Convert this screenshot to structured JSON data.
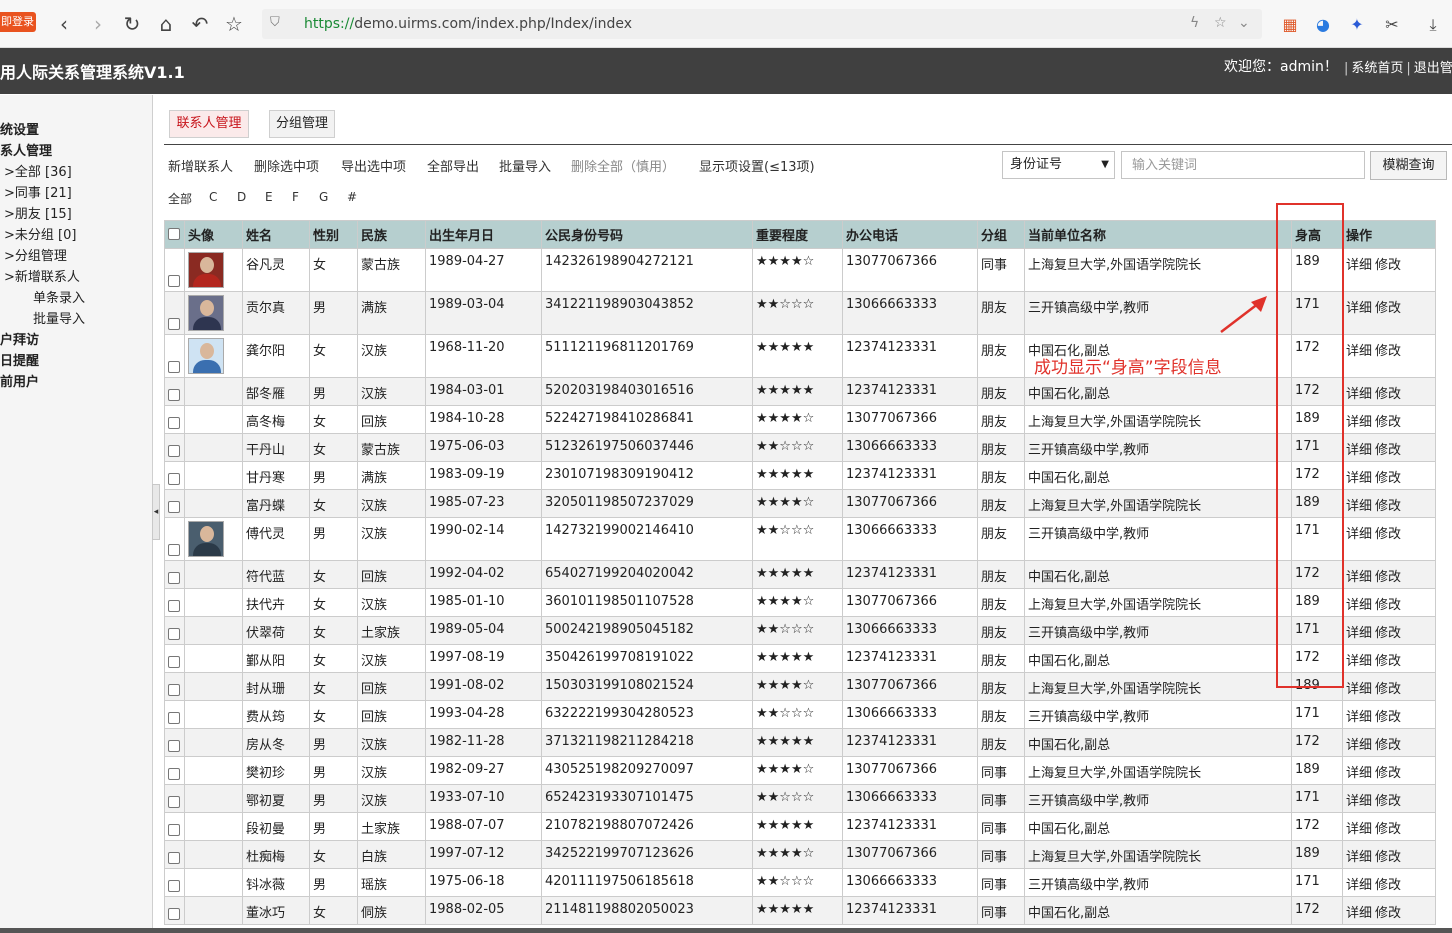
{
  "browser": {
    "login_badge": "即登录",
    "url_https": "https://",
    "url_rest": "demo.uirms.com/index.php/Index/index"
  },
  "header": {
    "title": "用人际关系管理系统V1.1",
    "welcome": "欢迎您：admin！",
    "home_link": "系统首页",
    "logout_link": "退出管"
  },
  "sidebar": {
    "items": [
      {
        "label": "统设置",
        "bold": true,
        "indent": 0
      },
      {
        "label": "系人管理",
        "bold": true,
        "indent": 0
      },
      {
        "label": ">全部 [36]",
        "bold": false,
        "indent": 4
      },
      {
        "label": ">同事 [21]",
        "bold": false,
        "indent": 4
      },
      {
        "label": ">朋友 [15]",
        "bold": false,
        "indent": 4
      },
      {
        "label": ">未分组 [0]",
        "bold": false,
        "indent": 4
      },
      {
        "label": ">分组管理",
        "bold": false,
        "indent": 4
      },
      {
        "label": ">新增联系人",
        "bold": false,
        "indent": 4
      },
      {
        "label": "单条录入",
        "bold": false,
        "indent": 33
      },
      {
        "label": "批量导入",
        "bold": false,
        "indent": 33
      },
      {
        "label": "户拜访",
        "bold": true,
        "indent": 0
      },
      {
        "label": "日提醒",
        "bold": true,
        "indent": 0
      },
      {
        "label": "前用户",
        "bold": true,
        "indent": 0
      }
    ]
  },
  "tabs": [
    {
      "label": "联系人管理",
      "active": true
    },
    {
      "label": "分组管理",
      "active": false
    }
  ],
  "toolbar": [
    {
      "label": "新增联系人",
      "dim": false
    },
    {
      "label": "删除选中项",
      "dim": false
    },
    {
      "label": "导出选中项",
      "dim": false
    },
    {
      "label": "全部导出",
      "dim": false
    },
    {
      "label": "批量导入",
      "dim": false
    },
    {
      "label": "删除全部（慎用）",
      "dim": true
    },
    {
      "label": "显示项设置(≤13项)",
      "dim": false
    }
  ],
  "search": {
    "field_selected": "身份证号",
    "placeholder": "输入关键词",
    "button": "模糊查询"
  },
  "letters": [
    "全部",
    "C",
    "D",
    "E",
    "F",
    "G",
    "#"
  ],
  "table": {
    "columns": [
      "头像",
      "姓名",
      "性别",
      "民族",
      "出生年月日",
      "公民身份号码",
      "重要程度",
      "办公电话",
      "分组",
      "当前单位名称",
      "身高",
      "操作"
    ],
    "op_detail": "详细",
    "op_edit": "修改",
    "rows": [
      {
        "photo": "red",
        "name": "谷凡灵",
        "gender": "女",
        "ethnic": "蒙古族",
        "dob": "1989-04-27",
        "id": "142326198904272121",
        "stars": "★★★★☆",
        "phone": "13077067366",
        "group": "同事",
        "org": "上海复旦大学,外国语学院院长",
        "height": "189"
      },
      {
        "photo": "suit",
        "name": "贡尔真",
        "gender": "男",
        "ethnic": "满族",
        "dob": "1989-03-04",
        "id": "341221198903043852",
        "stars": "★★☆☆☆",
        "phone": "13066663333",
        "group": "朋友",
        "org": "三开镇高级中学,教师",
        "height": "171"
      },
      {
        "photo": "light",
        "name": "龚尔阳",
        "gender": "女",
        "ethnic": "汉族",
        "dob": "1968-11-20",
        "id": "511121196811201769",
        "stars": "★★★★★",
        "phone": "12374123331",
        "group": "朋友",
        "org": "中国石化,副总",
        "height": "172"
      },
      {
        "photo": "",
        "name": "郜冬雁",
        "gender": "男",
        "ethnic": "汉族",
        "dob": "1984-03-01",
        "id": "520203198403016516",
        "stars": "★★★★★",
        "phone": "12374123331",
        "group": "朋友",
        "org": "中国石化,副总",
        "height": "172"
      },
      {
        "photo": "",
        "name": "高冬梅",
        "gender": "女",
        "ethnic": "回族",
        "dob": "1984-10-28",
        "id": "522427198410286841",
        "stars": "★★★★☆",
        "phone": "13077067366",
        "group": "朋友",
        "org": "上海复旦大学,外国语学院院长",
        "height": "189"
      },
      {
        "photo": "",
        "name": "干丹山",
        "gender": "女",
        "ethnic": "蒙古族",
        "dob": "1975-06-03",
        "id": "512326197506037446",
        "stars": "★★☆☆☆",
        "phone": "13066663333",
        "group": "朋友",
        "org": "三开镇高级中学,教师",
        "height": "171"
      },
      {
        "photo": "",
        "name": "甘丹寒",
        "gender": "男",
        "ethnic": "满族",
        "dob": "1983-09-19",
        "id": "230107198309190412",
        "stars": "★★★★★",
        "phone": "12374123331",
        "group": "朋友",
        "org": "中国石化,副总",
        "height": "172"
      },
      {
        "photo": "",
        "name": "富丹蝶",
        "gender": "女",
        "ethnic": "汉族",
        "dob": "1985-07-23",
        "id": "320501198507237029",
        "stars": "★★★★☆",
        "phone": "13077067366",
        "group": "朋友",
        "org": "上海复旦大学,外国语学院院长",
        "height": "189"
      },
      {
        "photo": "dark",
        "name": "傅代灵",
        "gender": "男",
        "ethnic": "汉族",
        "dob": "1990-02-14",
        "id": "142732199002146410",
        "stars": "★★☆☆☆",
        "phone": "13066663333",
        "group": "朋友",
        "org": "三开镇高级中学,教师",
        "height": "171"
      },
      {
        "photo": "",
        "name": "符代蓝",
        "gender": "女",
        "ethnic": "回族",
        "dob": "1992-04-02",
        "id": "654027199204020042",
        "stars": "★★★★★",
        "phone": "12374123331",
        "group": "朋友",
        "org": "中国石化,副总",
        "height": "172"
      },
      {
        "photo": "",
        "name": "扶代卉",
        "gender": "女",
        "ethnic": "汉族",
        "dob": "1985-01-10",
        "id": "360101198501107528",
        "stars": "★★★★☆",
        "phone": "13077067366",
        "group": "朋友",
        "org": "上海复旦大学,外国语学院院长",
        "height": "189"
      },
      {
        "photo": "",
        "name": "伏翠荷",
        "gender": "女",
        "ethnic": "土家族",
        "dob": "1989-05-04",
        "id": "500242198905045182",
        "stars": "★★☆☆☆",
        "phone": "13066663333",
        "group": "朋友",
        "org": "三开镇高级中学,教师",
        "height": "171"
      },
      {
        "photo": "",
        "name": "鄞从阳",
        "gender": "女",
        "ethnic": "汉族",
        "dob": "1997-08-19",
        "id": "350426199708191022",
        "stars": "★★★★★",
        "phone": "12374123331",
        "group": "朋友",
        "org": "中国石化,副总",
        "height": "172"
      },
      {
        "photo": "",
        "name": "封从珊",
        "gender": "女",
        "ethnic": "回族",
        "dob": "1991-08-02",
        "id": "150303199108021524",
        "stars": "★★★★☆",
        "phone": "13077067366",
        "group": "朋友",
        "org": "上海复旦大学,外国语学院院长",
        "height": "189"
      },
      {
        "photo": "",
        "name": "费从筠",
        "gender": "女",
        "ethnic": "回族",
        "dob": "1993-04-28",
        "id": "632222199304280523",
        "stars": "★★☆☆☆",
        "phone": "13066663333",
        "group": "朋友",
        "org": "三开镇高级中学,教师",
        "height": "171"
      },
      {
        "photo": "",
        "name": "房从冬",
        "gender": "男",
        "ethnic": "汉族",
        "dob": "1982-11-28",
        "id": "371321198211284218",
        "stars": "★★★★★",
        "phone": "12374123331",
        "group": "朋友",
        "org": "中国石化,副总",
        "height": "172"
      },
      {
        "photo": "",
        "name": "樊初珍",
        "gender": "男",
        "ethnic": "汉族",
        "dob": "1982-09-27",
        "id": "430525198209270097",
        "stars": "★★★★☆",
        "phone": "13077067366",
        "group": "同事",
        "org": "上海复旦大学,外国语学院院长",
        "height": "189"
      },
      {
        "photo": "",
        "name": "鄂初夏",
        "gender": "男",
        "ethnic": "汉族",
        "dob": "1933-07-10",
        "id": "652423193307101475",
        "stars": "★★☆☆☆",
        "phone": "13066663333",
        "group": "同事",
        "org": "三开镇高级中学,教师",
        "height": "171"
      },
      {
        "photo": "",
        "name": "段初曼",
        "gender": "男",
        "ethnic": "土家族",
        "dob": "1988-07-07",
        "id": "210782198807072426",
        "stars": "★★★★★",
        "phone": "12374123331",
        "group": "同事",
        "org": "中国石化,副总",
        "height": "172"
      },
      {
        "photo": "",
        "name": "杜痴梅",
        "gender": "女",
        "ethnic": "白族",
        "dob": "1997-07-12",
        "id": "342522199707123626",
        "stars": "★★★★☆",
        "phone": "13077067366",
        "group": "同事",
        "org": "上海复旦大学,外国语学院院长",
        "height": "189"
      },
      {
        "photo": "",
        "name": "钭冰薇",
        "gender": "男",
        "ethnic": "瑶族",
        "dob": "1975-06-18",
        "id": "420111197506185618",
        "stars": "★★☆☆☆",
        "phone": "13066663333",
        "group": "同事",
        "org": "三开镇高级中学,教师",
        "height": "171"
      },
      {
        "photo": "",
        "name": "董冰巧",
        "gender": "女",
        "ethnic": "侗族",
        "dob": "1988-02-05",
        "id": "211481198802050023",
        "stars": "★★★★★",
        "phone": "12374123331",
        "group": "同事",
        "org": "中国石化,副总",
        "height": "172"
      }
    ]
  },
  "annotation": {
    "text": "成功显示“身高”字段信息",
    "color": "#e0322b"
  },
  "colors": {
    "header_bg": "#404040",
    "table_header_bg": "#b6cfcf",
    "active_tab": "#c7141b"
  }
}
